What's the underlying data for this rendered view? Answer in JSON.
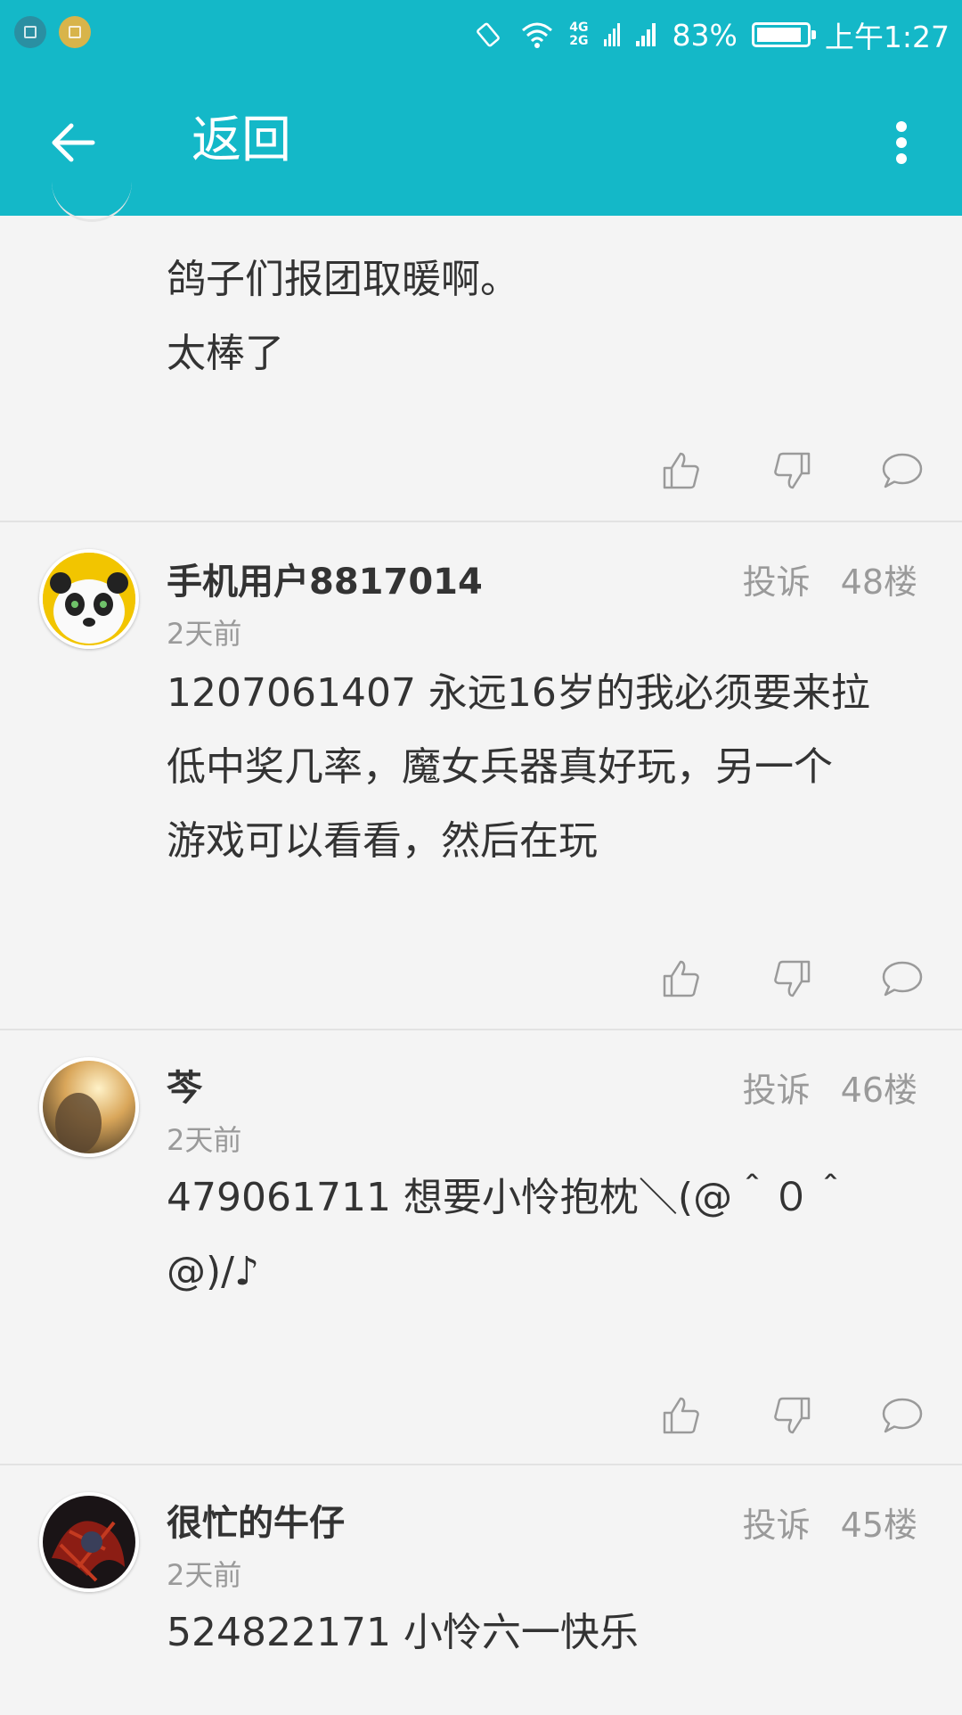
{
  "status_bar": {
    "network": [
      "4G",
      "2G"
    ],
    "battery": "83%",
    "time": "上午1:27"
  },
  "topbar": {
    "back_label": "返回"
  },
  "first_comment": {
    "lines": [
      "鸽子们报团取暖啊。",
      "太棒了"
    ]
  },
  "comments": [
    {
      "username": "手机用户8817014",
      "time": "2天前",
      "report": "投诉",
      "floor": "48楼",
      "content": [
        "1207061407 永远16岁的我必须要来拉",
        "低中奖几率，魔女兵器真好玩，另一个",
        "游戏可以看看，然后在玩"
      ]
    },
    {
      "username": "芩",
      "time": "2天前",
      "report": "投诉",
      "floor": "46楼",
      "content": [
        "479061711  想要小怜抱枕＼(@＾０＾",
        "@)/♪"
      ]
    },
    {
      "username": "很忙的牛仔",
      "time": "2天前",
      "report": "投诉",
      "floor": "45楼",
      "content": [
        "524822171 小怜六一快乐"
      ]
    }
  ],
  "colors": {
    "accent": "#14b8c8",
    "background": "#f4f4f4",
    "text": "#333333",
    "muted": "#9a9a9a"
  },
  "icons": [
    "back-arrow-icon",
    "more-vert-icon",
    "thumbs-up-icon",
    "thumbs-down-icon",
    "comment-bubble-icon"
  ]
}
